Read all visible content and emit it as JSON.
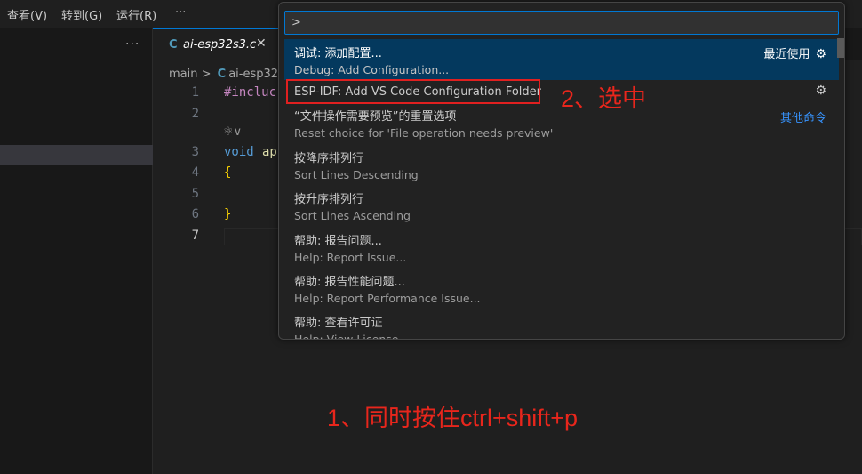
{
  "menubar": {
    "items": [
      "查看(V)",
      "转到(G)",
      "运行(R)",
      "···"
    ]
  },
  "sidebar": {
    "more_label": "···"
  },
  "editor": {
    "tab": {
      "icon": "C",
      "name": "ai-esp32s3.c",
      "close": "✕"
    },
    "breadcrumb": {
      "folder": "main",
      "sep": ">",
      "icon": "C",
      "file": "ai-esp32"
    },
    "line_numbers": [
      "1",
      "2",
      "3",
      "4",
      "5",
      "6",
      "7"
    ],
    "code": {
      "line1": "#incluc",
      "line3_kw": "void",
      "line3_rest": "ap",
      "line4": "{",
      "line6": "}"
    },
    "codelens": "⚛︎∨"
  },
  "palette": {
    "input_value": ">",
    "items": [
      {
        "title": "调试: 添加配置...",
        "subtitle": "Debug: Add Configuration...",
        "right_label": "最近使用",
        "icon": "gear-icon"
      },
      {
        "title": "ESP-IDF: Add VS Code Configuration Folder",
        "icon": "gear-icon"
      },
      {
        "title": "“文件操作需要预览”的重置选项",
        "subtitle": "Reset choice for 'File operation needs preview'",
        "right_link": "其他命令"
      },
      {
        "title": "按降序排列行",
        "subtitle": "Sort Lines Descending"
      },
      {
        "title": "按升序排列行",
        "subtitle": "Sort Lines Ascending"
      },
      {
        "title": "帮助: 报告问题...",
        "subtitle": "Help: Report Issue..."
      },
      {
        "title": "帮助: 报告性能问题...",
        "subtitle": "Help: Report Performance Issue..."
      },
      {
        "title": "帮助: 查看许可证",
        "subtitle": "Help: View License"
      }
    ]
  },
  "annotations": {
    "step2": "2、选中",
    "step1": "1、同时按住ctrl+shift+p"
  },
  "colors": {
    "accent": "#0078d4",
    "selected_bg": "#04395e",
    "annotation_red": "#e8261c"
  }
}
